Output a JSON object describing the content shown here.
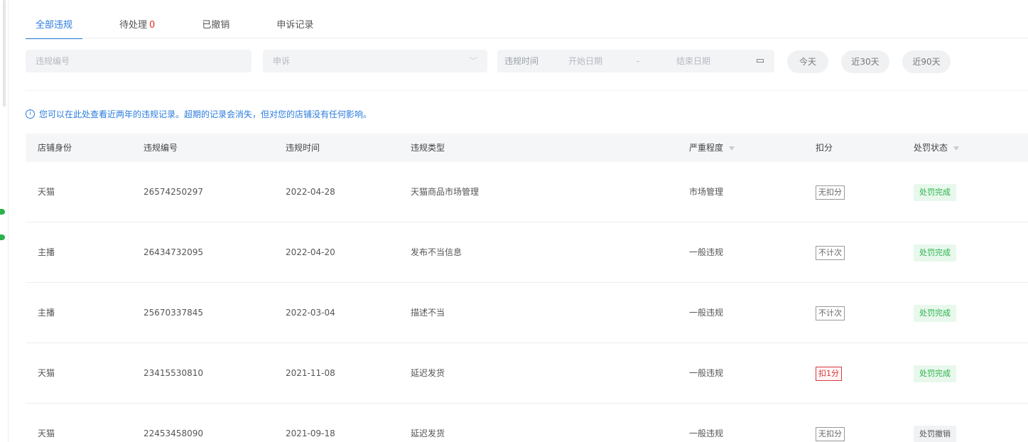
{
  "tabs": [
    {
      "label": "全部违规",
      "count": "",
      "active": true
    },
    {
      "label": "待处理",
      "count": "0",
      "active": false
    },
    {
      "label": "已撤销",
      "count": "",
      "active": false
    },
    {
      "label": "申诉记录",
      "count": "",
      "active": false
    }
  ],
  "filters": {
    "id_placeholder": "违规编号",
    "appeal_select": "申诉",
    "time_label": "违规时间",
    "start_placeholder": "开始日期",
    "range_sep": "-",
    "end_placeholder": "结束日期",
    "quick": {
      "today": "今天",
      "last30": "近30天",
      "last90": "近90天"
    }
  },
  "notice": "您可以在此处查看近两年的违规记录。超期的记录会消失，但对您的店铺没有任何影响。",
  "table": {
    "headers": {
      "shop": "店铺身份",
      "id": "违规编号",
      "time": "违规时间",
      "type": "违规类型",
      "severity": "严重程度",
      "points": "扣分",
      "status": "处罚状态"
    },
    "rows": [
      {
        "shop": "天猫",
        "id": "26574250297",
        "time": "2022-04-28",
        "type": "天猫商品市场管理",
        "severity": "市场管理",
        "points": "无扣分",
        "points_style": "normal",
        "status": "处罚完成",
        "status_style": "done"
      },
      {
        "shop": "主播",
        "id": "26434732095",
        "time": "2022-04-20",
        "type": "发布不当信息",
        "severity": "一般违规",
        "points": "不计次",
        "points_style": "normal",
        "status": "处罚完成",
        "status_style": "done"
      },
      {
        "shop": "主播",
        "id": "25670337845",
        "time": "2022-03-04",
        "type": "描述不当",
        "severity": "一般违规",
        "points": "不计次",
        "points_style": "normal",
        "status": "处罚完成",
        "status_style": "done"
      },
      {
        "shop": "天猫",
        "id": "23415530810",
        "time": "2021-11-08",
        "type": "延迟发货",
        "severity": "一般违规",
        "points": "扣1分",
        "points_style": "red",
        "status": "处罚完成",
        "status_style": "done"
      },
      {
        "shop": "天猫",
        "id": "22453458090",
        "time": "2021-09-18",
        "type": "延迟发货",
        "severity": "一般违规",
        "points": "无扣分",
        "points_style": "normal",
        "status": "处罚撤销",
        "status_style": "revoked"
      }
    ]
  },
  "colors": {
    "accent": "#2a7cde",
    "danger": "#d9363e",
    "success": "#2bb24c"
  }
}
